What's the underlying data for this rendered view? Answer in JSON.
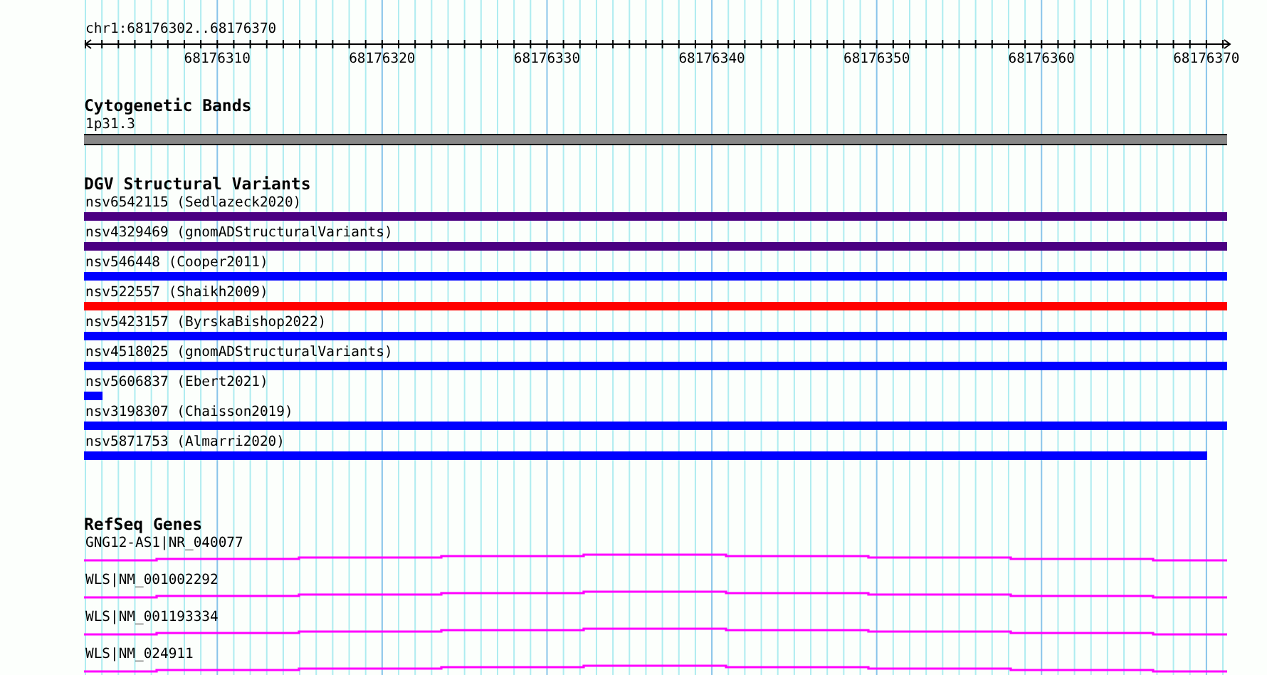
{
  "ruler": {
    "position": "chr1:68176302..68176370",
    "tick_labels": [
      "68176310",
      "68176320",
      "68176330",
      "68176340",
      "68176350",
      "68176360",
      "68176370"
    ]
  },
  "tracks": [
    {
      "kind": "cytoband",
      "title": "Cytogenetic Bands",
      "features": [
        {
          "label": "1p31.3"
        }
      ]
    },
    {
      "kind": "variants",
      "title": "DGV Structural Variants",
      "features": [
        {
          "label": "nsv6542115 (Sedlazeck2020)",
          "color": "#4b0082",
          "kind": "full"
        },
        {
          "label": "nsv4329469 (gnomADStructuralVariants)",
          "color": "#4b0082",
          "kind": "full"
        },
        {
          "label": "nsv546448 (Cooper2011)",
          "color": "#0000ff",
          "kind": "full"
        },
        {
          "label": "nsv522557 (Shaikh2009)",
          "color": "#ff0000",
          "kind": "full"
        },
        {
          "label": "nsv5423157 (ByrskaBishop2022)",
          "color": "#0000ff",
          "kind": "full"
        },
        {
          "label": "nsv4518025 (gnomADStructuralVariants)",
          "color": "#0000ff",
          "kind": "full"
        },
        {
          "label": "nsv5606837 (Ebert2021)",
          "color": "#0000ff",
          "kind": "short"
        },
        {
          "label": "nsv3198307 (Chaisson2019)",
          "color": "#0000ff",
          "kind": "full"
        },
        {
          "label": "nsv5871753 (Almarri2020)",
          "color": "#0000ff",
          "kind": "ends-early"
        }
      ]
    },
    {
      "kind": "genes",
      "title": "RefSeq Genes",
      "features": [
        {
          "label": "GNG12-AS1|NR_040077"
        },
        {
          "label": "WLS|NM_001002292"
        },
        {
          "label": "WLS|NM_001193334"
        },
        {
          "label": "WLS|NM_024911"
        }
      ]
    }
  ]
}
